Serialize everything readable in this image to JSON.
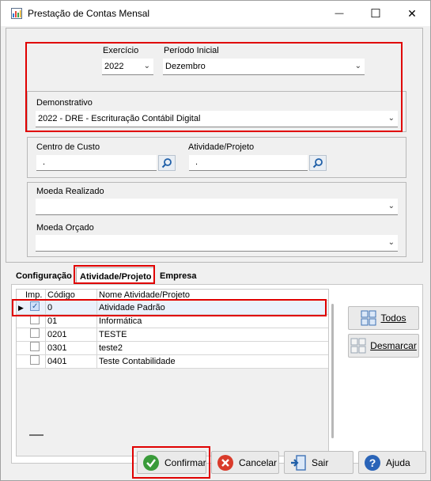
{
  "window": {
    "title": "Prestação de Contas Mensal",
    "minimize_glyph": "—",
    "maximize_glyph": "☐",
    "close_glyph": "✕"
  },
  "params": {
    "exercicio_label": "Exercício",
    "exercicio_value": "2022",
    "periodo_label": "Período Inicial",
    "periodo_value": "Dezembro",
    "demonstrativo_label": "Demonstrativo",
    "demonstrativo_value": "2022 - DRE - Escrituração Contábil Digital",
    "centro_label": "Centro de Custo",
    "centro_value": ".",
    "atividade_label": "Atividade/Projeto",
    "atividade_value": ".",
    "moeda_realizado_label": "Moeda Realizado",
    "moeda_realizado_value": "",
    "moeda_orcado_label": "Moeda Orçado",
    "moeda_orcado_value": ""
  },
  "tabs": [
    {
      "label": "Configuração"
    },
    {
      "label": "Atividade/Projeto"
    },
    {
      "label": "Empresa"
    }
  ],
  "grid": {
    "col_imp": "Imp.",
    "col_codigo": "Código",
    "col_nome": "Nome Atividade/Projeto",
    "rows": [
      {
        "codigo": "0",
        "nome": "Atividade Padrão",
        "checked": true
      },
      {
        "codigo": "01",
        "nome": "Informática",
        "checked": false
      },
      {
        "codigo": "0201",
        "nome": "TESTE",
        "checked": false
      },
      {
        "codigo": "0301",
        "nome": "teste2",
        "checked": false
      },
      {
        "codigo": "0401",
        "nome": "Teste Contabilidade",
        "checked": false
      }
    ]
  },
  "side_buttons": {
    "todos_label": "Todos",
    "desmarcar_label": "Desmarcar"
  },
  "bottom_buttons": {
    "confirmar_label": "Confirmar",
    "cancelar_label": "Cancelar",
    "sair_label": "Sair",
    "ajuda_label": "Ajuda"
  },
  "colors": {
    "highlight_red": "#e00000",
    "confirm_green": "#3a9b3a",
    "cancel_red": "#d93b2b",
    "help_blue": "#2a64b8"
  }
}
